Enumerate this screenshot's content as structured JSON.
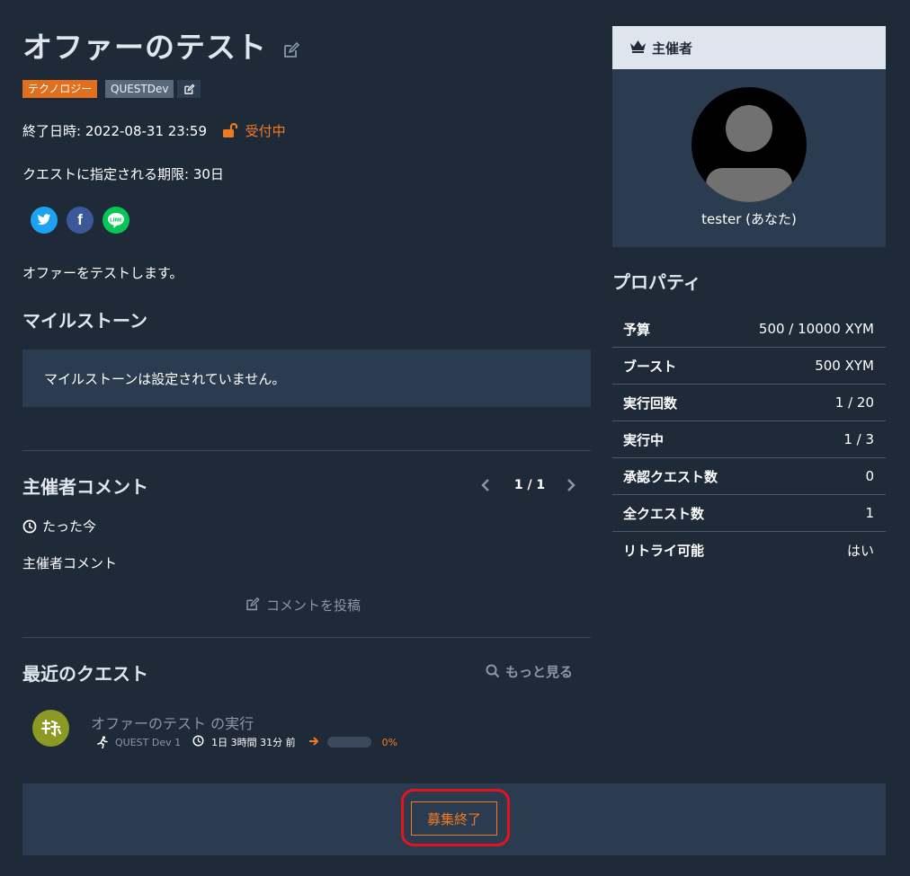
{
  "offer": {
    "title": "オファーのテスト",
    "tags": [
      "テクノロジー",
      "QUESTDev"
    ],
    "end_date_label": "終了日時: 2022-08-31 23:59",
    "status": "受付中",
    "deadline_label": "クエストに指定される期限: 30日",
    "description": "オファーをテストします。"
  },
  "milestones": {
    "heading": "マイルストーン",
    "empty_text": "マイルストーンは設定されていません。"
  },
  "comments": {
    "heading": "主催者コメント",
    "pager": "1 / 1",
    "time": "たった今",
    "body": "主催者コメント",
    "post_label": "コメントを投稿"
  },
  "recent": {
    "heading": "最近のクエスト",
    "more_label": "もっと見る",
    "items": [
      {
        "title": "オファーのテスト の実行",
        "user": "QUEST Dev 1",
        "time": "1日 3時間 31分 前",
        "progress_text": "0%",
        "progress": 0
      }
    ]
  },
  "close_button": "募集終了",
  "organizer": {
    "heading": "主催者",
    "name": "tester (あなた)"
  },
  "properties": {
    "heading": "プロパティ",
    "rows": [
      {
        "key": "予算",
        "value": "500 / 10000 XYM",
        "color": "green"
      },
      {
        "key": "ブースト",
        "value": "500 XYM",
        "color": "white"
      },
      {
        "key": "実行回数",
        "value": "1 / 20",
        "color": "green"
      },
      {
        "key": "実行中",
        "value": "1 / 3",
        "color": "green"
      },
      {
        "key": "承認クエスト数",
        "value": "0",
        "color": "white"
      },
      {
        "key": "全クエスト数",
        "value": "1",
        "color": "white"
      },
      {
        "key": "リトライ可能",
        "value": "はい",
        "color": "white"
      }
    ]
  },
  "social": [
    "twitter-icon",
    "facebook-icon",
    "line-icon"
  ],
  "colors": {
    "accent": "#f07a23",
    "green": "#4bbf5a",
    "background": "#1f2a38",
    "panel": "#2b3c50",
    "highlight": "#e3141e"
  }
}
